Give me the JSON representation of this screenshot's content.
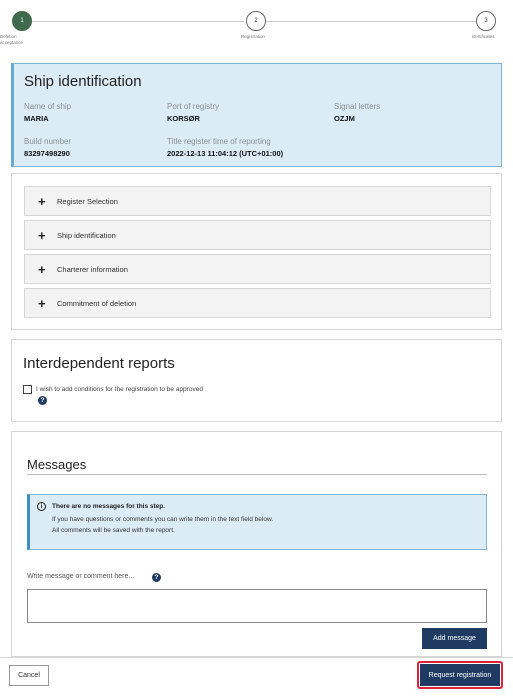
{
  "stepper": {
    "steps": [
      {
        "number": "1",
        "label": "Deletion acceptance",
        "state": "active"
      },
      {
        "number": "2",
        "label": "Registration",
        "state": "pending"
      },
      {
        "number": "3",
        "label": "Certificates",
        "state": "pending"
      }
    ]
  },
  "ship_card": {
    "title": "Ship identification",
    "fields": [
      {
        "label": "Name of ship",
        "value": "MARIA"
      },
      {
        "label": "Port of registry",
        "value": "KORSØR"
      },
      {
        "label": "Signal letters",
        "value": "OZJM"
      },
      {
        "label": "Build number",
        "value": "83297498290"
      },
      {
        "label": "Title register time of reporting",
        "value": "2022-12-13 11:04:12 (UTC+01:00)"
      }
    ]
  },
  "accordion": {
    "items": [
      {
        "label": "Register Selection"
      },
      {
        "label": "Ship identification"
      },
      {
        "label": "Charterer information"
      },
      {
        "label": "Commitment of deletion"
      }
    ]
  },
  "interdependent": {
    "title": "Interdependent reports",
    "checkbox_label": "I wish to add conditions for the registration to be approved",
    "checked": false
  },
  "messages": {
    "title": "Messages",
    "info_title": "There are no messages for this step.",
    "info_line1": "If you have questions or comments you can write them in the text field below.",
    "info_line2": "All comments will be saved with the report.",
    "input_label": "Write message or comment here...",
    "input_value": "",
    "add_button": "Add message"
  },
  "footer": {
    "cancel_button": "Cancel",
    "submit_button": "Request registration"
  },
  "colors": {
    "primary": "#1f3b63",
    "active_step": "#3f6b4c",
    "info_bg": "#dcecf6",
    "highlight": "#d9233b"
  }
}
